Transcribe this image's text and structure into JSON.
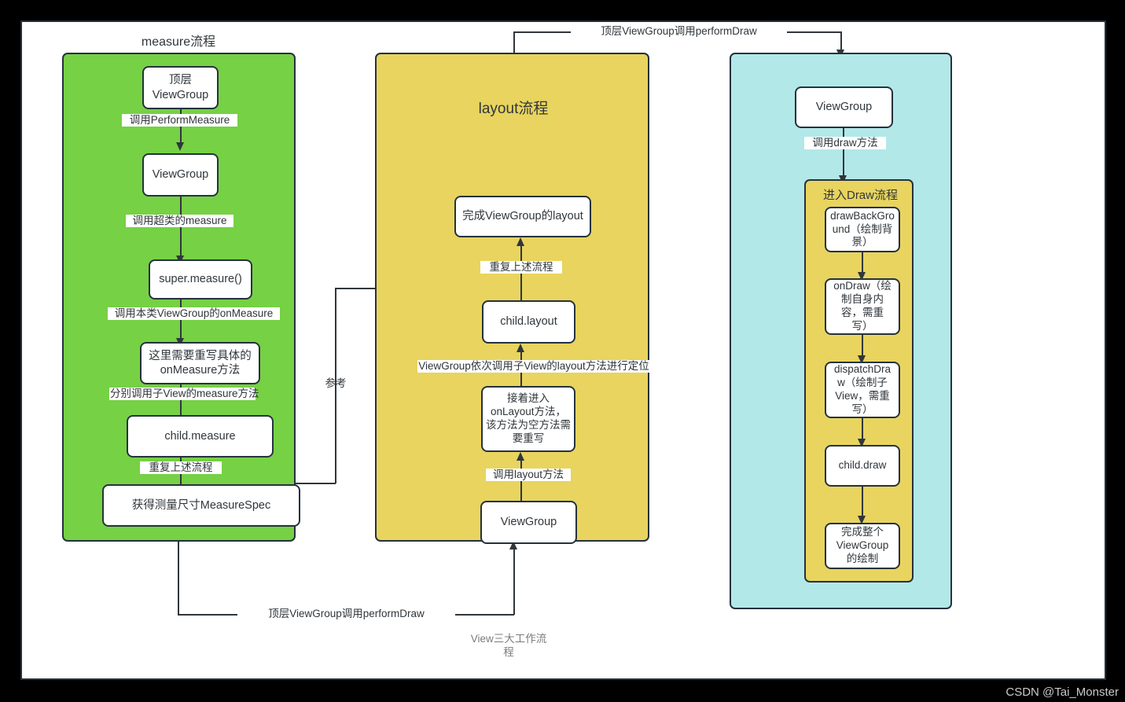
{
  "canvas": {
    "caption": "View三大工作流\n程",
    "watermark": "CSDN @Tai_Monster"
  },
  "colors": {
    "measure_lane": "#76d144",
    "layout_lane": "#e8d45e",
    "draw_lane": "#b2e8e8",
    "draw_inner": "#e8d45e",
    "node_fill": "#ffffff",
    "stroke": "#25323c",
    "text": "#30363b",
    "caption_text": "#7b7b7b",
    "watermark_text": "#c9c9c9",
    "page_background": "#000000",
    "canvas_background": "#ffffff"
  },
  "measure_lane": {
    "title": "measure流程",
    "nodes": [
      {
        "id": "top-viewgroup",
        "label": "顶层\nViewGroup"
      },
      {
        "id": "viewgroup",
        "label": "ViewGroup"
      },
      {
        "id": "super-measure",
        "label": "super.measure()"
      },
      {
        "id": "override-onmeasure",
        "label": "这里需要重写具体的\nonMeasure方法"
      },
      {
        "id": "child-measure",
        "label": "child.measure"
      },
      {
        "id": "measurespec",
        "label": "获得测量尺寸MeasureSpec"
      }
    ],
    "edge_labels": [
      {
        "id": "call-performmeasure",
        "label": "调用PerformMeasure"
      },
      {
        "id": "call-super-measure",
        "label": "调用超类的measure"
      },
      {
        "id": "call-onmeasure",
        "label": "调用本类ViewGroup的onMeasure"
      },
      {
        "id": "call-child-measure",
        "label": "分别调用子View的measure方法"
      },
      {
        "id": "repeat-flow",
        "label": "重复上述流程"
      }
    ]
  },
  "layout_lane": {
    "title": "layout流程",
    "nodes": [
      {
        "id": "finish-layout",
        "label": "完成ViewGroup的layout"
      },
      {
        "id": "child-layout",
        "label": "child.layout"
      },
      {
        "id": "onlayout",
        "label": "接着进入\nonLayout方法，\n该方法为空方法需\n要重写"
      },
      {
        "id": "viewgroup",
        "label": "ViewGroup"
      }
    ],
    "edge_labels": [
      {
        "id": "repeat-flow",
        "label": "重复上述流程"
      },
      {
        "id": "call-child-layout",
        "label": "ViewGroup依次调用子View的layout方法进行定位"
      },
      {
        "id": "call-layout",
        "label": "调用layout方法"
      }
    ]
  },
  "draw_lane": {
    "top_node": {
      "id": "viewgroup",
      "label": "ViewGroup"
    },
    "edge_label_call_draw": "调用draw方法",
    "inner_title": "进入Draw流程",
    "inner_nodes": [
      {
        "id": "drawbackground",
        "label": "drawBackGro\nund（绘制背\n景）"
      },
      {
        "id": "ondraw",
        "label": "onDraw（绘\n制自身内\n容，需重\n写）"
      },
      {
        "id": "dispatchdraw",
        "label": "dispatchDra\nw（绘制子\nView，需重\n写）"
      },
      {
        "id": "child-draw",
        "label": "child.draw"
      },
      {
        "id": "finish-draw",
        "label": "完成整个\nViewGroup\n的绘制"
      }
    ]
  },
  "connectors": {
    "reference": "参考",
    "top_performdraw": "顶层ViewGroup调用performDraw",
    "bottom_performdraw": "顶层ViewGroup调用performDraw"
  }
}
